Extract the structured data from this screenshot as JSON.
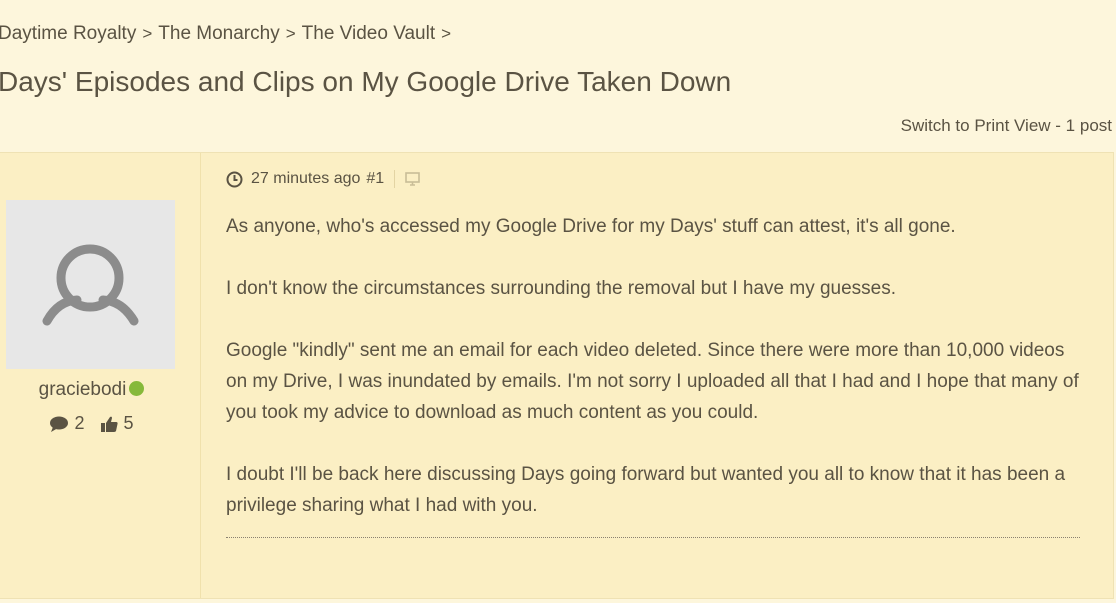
{
  "breadcrumb": {
    "items": [
      "Daytime Royalty",
      "The Monarchy",
      "The Video Vault"
    ],
    "separator": ">"
  },
  "thread": {
    "title": "Days' Episodes and Clips on My Google Drive Taken Down",
    "print_view_label": "Switch to Print View",
    "post_count_label": "- 1 post"
  },
  "post": {
    "author": {
      "username": "graciebodi",
      "online": true,
      "posts_count": "2",
      "likes_count": "5"
    },
    "meta": {
      "time": "27 minutes ago",
      "number": "#1"
    },
    "paragraphs": [
      "As anyone, who's accessed my Google Drive for my Days' stuff can attest, it's all gone.",
      "I don't know the circumstances surrounding the removal but I have my guesses.",
      "Google \"kindly\" sent me an email for each video deleted.  Since there were more than 10,000 videos on my Drive, I was inundated by emails.  I'm not sorry I uploaded all that I had and I hope that many of you took my advice to download as much content as you could.",
      "I doubt I'll be back here discussing Days going forward but wanted you all to know that it has been a privilege sharing what I had with you."
    ]
  },
  "colors": {
    "page_background": "#fdf6dc",
    "post_background": "#fbefc4",
    "text": "#5a5343",
    "online_status": "#86b93a",
    "avatar_background": "#e7e7e7",
    "avatar_figure": "#8c8c8c"
  },
  "icons": {
    "clock": "clock-icon",
    "device": "desktop-icon",
    "posts": "speech-bubble-icon",
    "likes": "thumbs-up-icon"
  }
}
